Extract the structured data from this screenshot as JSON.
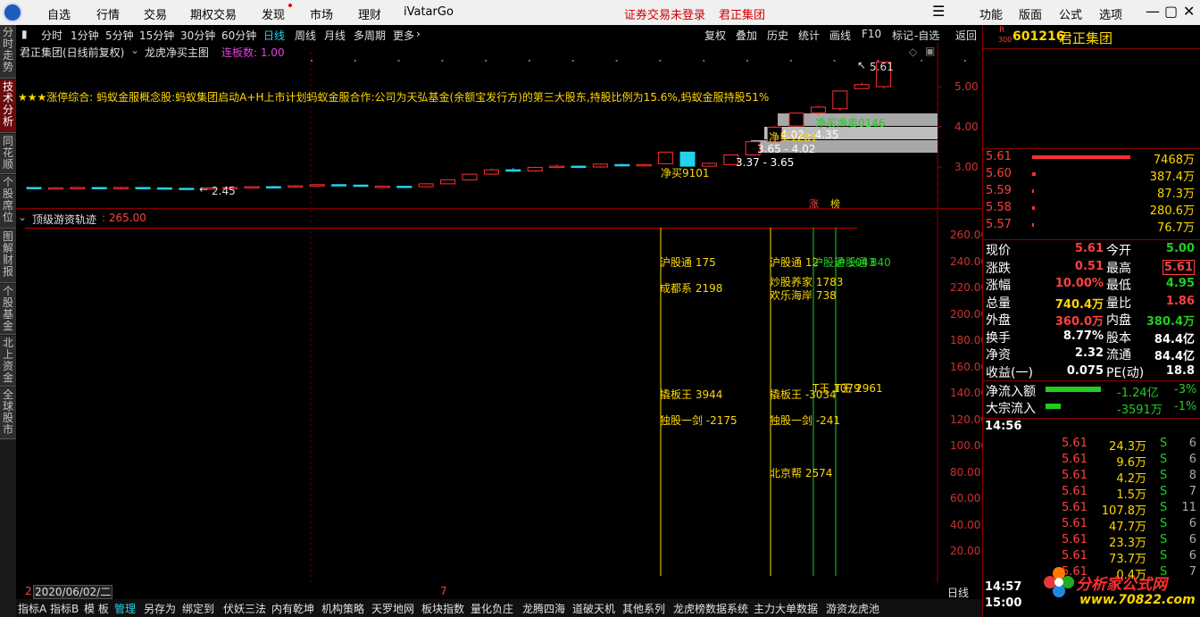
{
  "menu": {
    "items": [
      "自选",
      "行情",
      "交易",
      "期权交易",
      "发现",
      "市场",
      "理财",
      "iVatarGo"
    ],
    "login_status": "证券交易未登录",
    "stock_name": "君正集团",
    "right_items": [
      "功能",
      "版面",
      "公式",
      "选项"
    ]
  },
  "left_tabs": [
    "分时走势",
    "技术分析",
    "同花顺",
    "个股席位",
    "图解财报",
    "个股基金",
    "北上资金",
    "全球股市"
  ],
  "chart_toolbar": {
    "periods": [
      "分时",
      "1分钟",
      "5分钟",
      "15分钟",
      "30分钟",
      "60分钟",
      "日线",
      "周线",
      "月线",
      "多周期",
      "更多"
    ],
    "selected": "日线",
    "tools": [
      "复权",
      "叠加",
      "历史",
      "统计",
      "画线",
      "F10",
      "标记",
      "-自选",
      "返回"
    ]
  },
  "main_chart": {
    "title": "君正集团(日线前复权)",
    "indicator_name": "龙虎净买主图",
    "limit_label": "连板数: 1.00",
    "news": "★★★涨停综合:    蚂蚁金服概念股:蚂蚁集团启动A+H上市计划蚂蚁金服合作:公司为天弘基金(余额宝发行方)的第三大股东,持股比例为15.6%,蚂蚁金服持股51%",
    "high_label": "5.61",
    "low_label": "2.45",
    "range_labels": [
      "3.37 - 3.65",
      "3.65 - 4.02",
      "4.02 - 4.35"
    ],
    "gray_labels": [
      "净买净卖0146",
      "净买1281"
    ],
    "net_buy_label": "净买9101",
    "price_axis": [
      "5.00",
      "4.00",
      "3.00"
    ],
    "marks": [
      "涨",
      "榜"
    ]
  },
  "candles": [
    [
      2.49,
      2.48,
      2.5,
      2.47
    ],
    [
      2.48,
      2.48,
      2.5,
      2.46
    ],
    [
      2.48,
      2.49,
      2.51,
      2.47
    ],
    [
      2.49,
      2.48,
      2.5,
      2.47
    ],
    [
      2.48,
      2.49,
      2.51,
      2.47
    ],
    [
      2.49,
      2.48,
      2.5,
      2.47
    ],
    [
      2.48,
      2.47,
      2.49,
      2.46
    ],
    [
      2.47,
      2.45,
      2.48,
      2.45
    ],
    [
      2.46,
      2.48,
      2.5,
      2.45
    ],
    [
      2.48,
      2.49,
      2.51,
      2.47
    ],
    [
      2.49,
      2.51,
      2.52,
      2.48
    ],
    [
      2.51,
      2.5,
      2.53,
      2.49
    ],
    [
      2.5,
      2.53,
      2.55,
      2.49
    ],
    [
      2.53,
      2.56,
      2.58,
      2.52
    ],
    [
      2.56,
      2.54,
      2.58,
      2.53
    ],
    [
      2.55,
      2.52,
      2.56,
      2.51
    ],
    [
      2.52,
      2.52,
      2.54,
      2.5
    ],
    [
      2.52,
      2.5,
      2.53,
      2.49
    ],
    [
      2.51,
      2.58,
      2.6,
      2.5
    ],
    [
      2.58,
      2.68,
      2.7,
      2.57
    ],
    [
      2.68,
      2.82,
      2.84,
      2.66
    ],
    [
      2.82,
      2.93,
      2.96,
      2.8
    ],
    [
      2.93,
      2.9,
      2.98,
      2.88
    ],
    [
      2.9,
      2.99,
      3.01,
      2.88
    ],
    [
      3.0,
      3.02,
      3.06,
      2.98
    ],
    [
      3.02,
      2.99,
      3.04,
      2.97
    ],
    [
      3.0,
      3.07,
      3.09,
      2.98
    ],
    [
      3.06,
      3.03,
      3.08,
      3.01
    ],
    [
      3.04,
      3.06,
      3.08,
      3.01
    ],
    [
      3.08,
      3.37,
      3.38,
      3.06
    ],
    [
      3.37,
      3.02,
      3.37,
      3.0
    ],
    [
      3.02,
      3.09,
      3.12,
      3.01
    ],
    [
      3.06,
      3.3,
      3.31,
      3.05
    ],
    [
      3.3,
      3.63,
      3.65,
      3.28
    ],
    [
      3.63,
      3.99,
      4.02,
      3.6
    ],
    [
      4.02,
      4.34,
      4.35,
      4.0
    ],
    [
      4.35,
      4.49,
      4.52,
      4.3
    ],
    [
      4.45,
      4.89,
      4.9,
      4.4
    ],
    [
      4.95,
      5.05,
      5.1,
      4.95
    ],
    [
      5.0,
      5.61,
      5.61,
      4.95
    ]
  ],
  "indicator": {
    "name": "顶级游资轨迹",
    "value": ": 265.00",
    "axis": [
      "260.00",
      "240.00",
      "220.00",
      "200.00",
      "180.00",
      "160.00",
      "140.00",
      "120.00",
      "100.00",
      "80.00",
      "60.00",
      "40.00",
      "20.00"
    ],
    "labels": [
      "沪股通 175",
      "成都系 2198",
      "撬板王 3944",
      "独股一剑 -2175",
      "沪股通 12",
      "沪股通 1043",
      "沪股通 840",
      "炒股养家 1783",
      "欢乐海岸 738",
      "撬板王 -3034",
      "T王 1079",
      "T王 2961",
      "独股一剑 -241",
      "北京帮 2574"
    ],
    "date": "2020/06/02/二",
    "date_prefix": "2",
    "x_mark": "7",
    "period_label": "日线"
  },
  "bottom_tabs": [
    "指标A",
    "指标B",
    "模 板",
    "管理",
    "另存为",
    "绑定到",
    "伏妖三法",
    "内有乾坤",
    "机构策略",
    "天罗地网",
    "板块指数",
    "量化负庄",
    "龙腾四海",
    "道破天机",
    "其他系列",
    "龙虎榜数据系统",
    "主力大单数据",
    "游资龙虎池"
  ],
  "quote": {
    "mark": "R",
    "mark_sub": "300",
    "code": "601216",
    "name": "君正集团",
    "order_book": [
      {
        "price": "5.61",
        "vol": "7468万"
      },
      {
        "price": "5.60",
        "vol": "387.4万"
      },
      {
        "price": "5.59",
        "vol": "87.3万"
      },
      {
        "price": "5.58",
        "vol": "280.6万"
      },
      {
        "price": "5.57",
        "vol": "76.7万"
      }
    ],
    "stats": [
      {
        "l1": "现价",
        "v1": "5.61",
        "l2": "今开",
        "v2": "5.00"
      },
      {
        "l1": "涨跌",
        "v1": "0.51",
        "l2": "最高",
        "v2": "5.61"
      },
      {
        "l1": "涨幅",
        "v1": "10.00%",
        "l2": "最低",
        "v2": "4.95"
      },
      {
        "l1": "总量",
        "v1": "740.4万",
        "l2": "量比",
        "v2": "1.86"
      },
      {
        "l1": "外盘",
        "v1": "360.0万",
        "l2": "内盘",
        "v2": "380.4万"
      },
      {
        "l1": "换手",
        "v1": "8.77%",
        "l2": "股本",
        "v2": "84.4亿"
      },
      {
        "l1": "净资",
        "v1": "2.32",
        "l2": "流通",
        "v2": "84.4亿"
      },
      {
        "l1": "收益(一)",
        "v1": "0.075",
        "l2": "PE(动)",
        "v2": "18.8"
      }
    ],
    "net_flow": {
      "label": "净流入额",
      "value": "-1.24亿",
      "pct": "-3%"
    },
    "block_flow": {
      "label": "大宗流入",
      "value": "-3591万",
      "pct": "-1%"
    },
    "trade_time": "14:56",
    "ticks": [
      {
        "price": "5.61",
        "vol": "24.3万",
        "side": "S",
        "n": "6"
      },
      {
        "price": "5.61",
        "vol": "9.6万",
        "side": "S",
        "n": "6"
      },
      {
        "price": "5.61",
        "vol": "4.2万",
        "side": "S",
        "n": "8"
      },
      {
        "price": "5.61",
        "vol": "1.5万",
        "side": "S",
        "n": "7"
      },
      {
        "price": "5.61",
        "vol": "107.8万",
        "side": "S",
        "n": "11"
      },
      {
        "price": "5.61",
        "vol": "47.7万",
        "side": "S",
        "n": "6"
      },
      {
        "price": "5.61",
        "vol": "23.3万",
        "side": "S",
        "n": "6"
      },
      {
        "price": "5.61",
        "vol": "73.7万",
        "side": "S",
        "n": "6"
      },
      {
        "price": "5.61",
        "vol": "0.4万",
        "side": "S",
        "n": "7"
      }
    ],
    "time1": "14:57",
    "time2": "15:00",
    "watermark": "分析家公式网",
    "watermark_url": "www.70822.com"
  }
}
